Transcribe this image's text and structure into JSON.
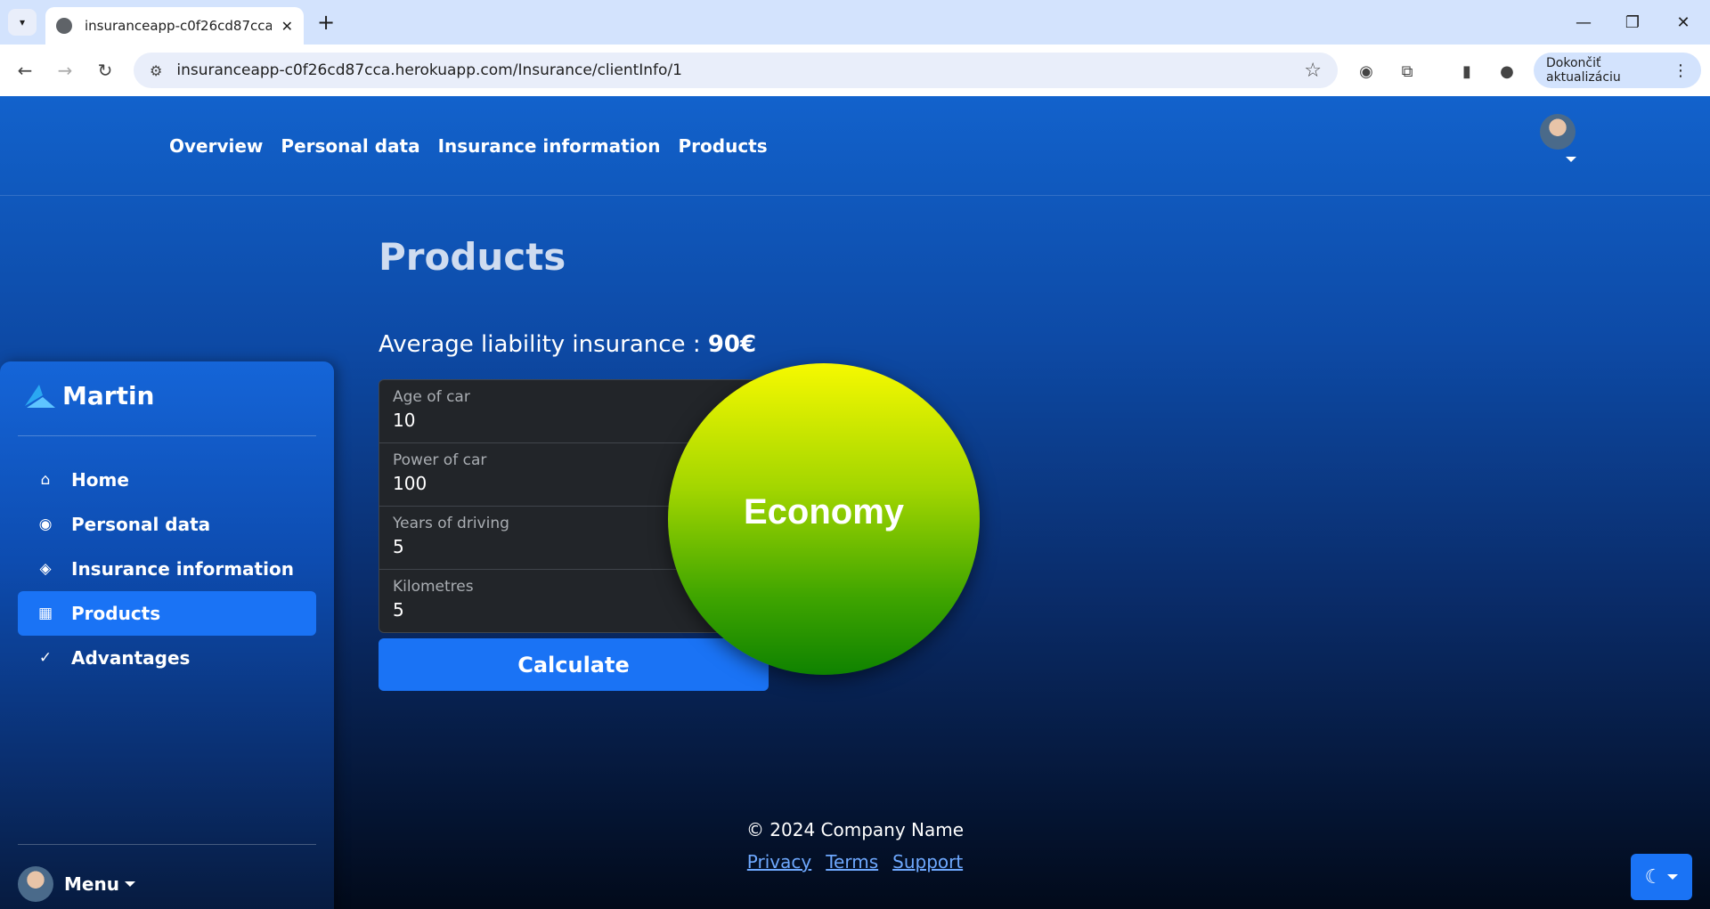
{
  "browser": {
    "tab_title": "insuranceapp-c0f26cd87cca.herokuapp.com",
    "url": "insuranceapp-c0f26cd87cca.herokuapp.com/Insurance/clientInfo/1",
    "update_label": "Dokončiť aktualizáciu"
  },
  "topnav": {
    "links": [
      "Overview",
      "Personal data",
      "Insurance information",
      "Products"
    ]
  },
  "sidebar": {
    "brand": "Martin",
    "items": [
      {
        "label": "Home",
        "icon": "home-icon"
      },
      {
        "label": "Personal data",
        "icon": "user-circle-icon"
      },
      {
        "label": "Insurance information",
        "icon": "shield-half-icon"
      },
      {
        "label": "Products",
        "icon": "grid-icon",
        "active": true
      },
      {
        "label": "Advantages",
        "icon": "shield-check-icon"
      }
    ],
    "menu_label": "Menu"
  },
  "main": {
    "title": "Products",
    "avg_label": "Average liability insurance :",
    "avg_value": "90€",
    "fields": [
      {
        "label": "Age of car",
        "value": "10"
      },
      {
        "label": "Power of car",
        "value": "100"
      },
      {
        "label": "Years of driving",
        "value": "5"
      },
      {
        "label": "Kilometres",
        "value": "5"
      }
    ],
    "calculate_label": "Calculate",
    "result": "Economy"
  },
  "footer": {
    "copyright": "© 2024 Company Name",
    "links": [
      "Privacy",
      "Terms",
      "Support"
    ]
  },
  "colors": {
    "accent": "#1a73f5",
    "result_top": "#f6f900",
    "result_bottom": "#0f8200"
  }
}
